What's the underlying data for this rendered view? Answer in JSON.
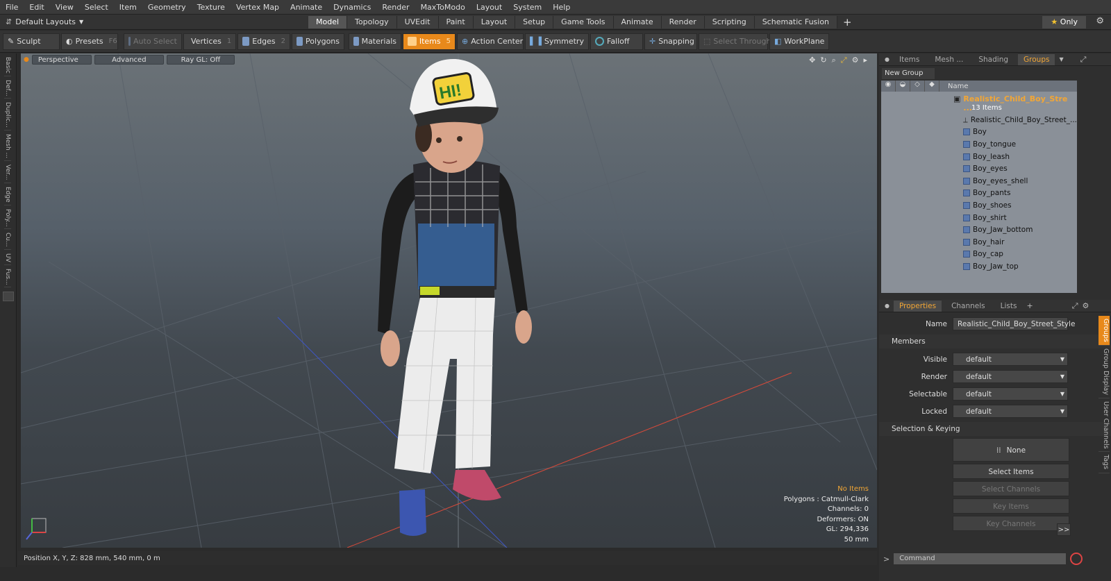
{
  "menubar": {
    "items": [
      "File",
      "Edit",
      "View",
      "Select",
      "Item",
      "Geometry",
      "Texture",
      "Vertex Map",
      "Animate",
      "Dynamics",
      "Render",
      "MaxToModo",
      "Layout",
      "System",
      "Help"
    ]
  },
  "layoutbar": {
    "layout_label": "Default Layouts",
    "tabs": [
      "Model",
      "Topology",
      "UVEdit",
      "Paint",
      "Layout",
      "Setup",
      "Game Tools",
      "Animate",
      "Render",
      "Scripting",
      "Schematic Fusion"
    ],
    "active_tab": "Model",
    "only_label": "Only"
  },
  "toolbar": {
    "sculpt": "Sculpt",
    "presets": "Presets",
    "presets_key": "F6",
    "auto_select": "Auto Select",
    "vertices": "Vertices",
    "vertices_key": "1",
    "edges": "Edges",
    "edges_key": "2",
    "polygons": "Polygons",
    "materials": "Materials",
    "items": "Items",
    "items_key": "5",
    "action_center": "Action Center",
    "symmetry": "Symmetry",
    "falloff": "Falloff",
    "snapping": "Snapping",
    "select_through": "Select Through",
    "workplane": "WorkPlane"
  },
  "left_strip": {
    "tabs": [
      "Basic",
      "Def...",
      "Duplic...",
      "Mesh ...",
      "Ver...",
      "Edge",
      "Poly...",
      "Cu...",
      "UV",
      "Fus..."
    ]
  },
  "viewport": {
    "view_mode": "Perspective",
    "shading": "Advanced",
    "raygl": "Ray GL: Off",
    "cap_text": "HI!",
    "info": {
      "items": "No Items",
      "polygons": "Polygons : Catmull-Clark",
      "channels": "Channels: 0",
      "deformers": "Deformers: ON",
      "gl": "GL: 294,336",
      "scale": "50 mm"
    }
  },
  "statusbar": {
    "position": "Position X, Y, Z:  828 mm, 540 mm, 0 m"
  },
  "rpanel": {
    "tabs": [
      "Items",
      "Mesh ...",
      "Shading",
      "Groups"
    ],
    "active_tab": "Groups",
    "new_group": "New Group",
    "name_header": "Name",
    "group": {
      "name": "Realistic_Child_Boy_Stre ...",
      "count": "13 Items"
    },
    "items": [
      "Realistic_Child_Boy_Street_...",
      "Boy",
      "Boy_tongue",
      "Boy_leash",
      "Boy_eyes",
      "Boy_eyes_shell",
      "Boy_pants",
      "Boy_shoes",
      "Boy_shirt",
      "Boy_Jaw_bottom",
      "Boy_hair",
      "Boy_cap",
      "Boy_Jaw_top"
    ]
  },
  "properties": {
    "tabs": [
      "Properties",
      "Channels",
      "Lists"
    ],
    "active_tab": "Properties",
    "name_label": "Name",
    "name_value": "Realistic_Child_Boy_Street_Style",
    "members_label": "Members",
    "visible_label": "Visible",
    "visible_value": "default",
    "render_label": "Render",
    "render_value": "default",
    "selectable_label": "Selectable",
    "selectable_value": "default",
    "locked_label": "Locked",
    "locked_value": "default",
    "sel_keying_label": "Selection & Keying",
    "none_label": "None",
    "select_items": "Select Items",
    "select_channels": "Select Channels",
    "key_items": "Key Items",
    "key_channels": "Key Channels",
    "more": ">>",
    "side_tabs": [
      "Groups",
      "Group Display",
      "User Channels",
      "Tags"
    ]
  },
  "command": {
    "placeholder": "Command"
  },
  "colors": {
    "accent": "#e8891b",
    "highlight_text": "#f2a635"
  }
}
